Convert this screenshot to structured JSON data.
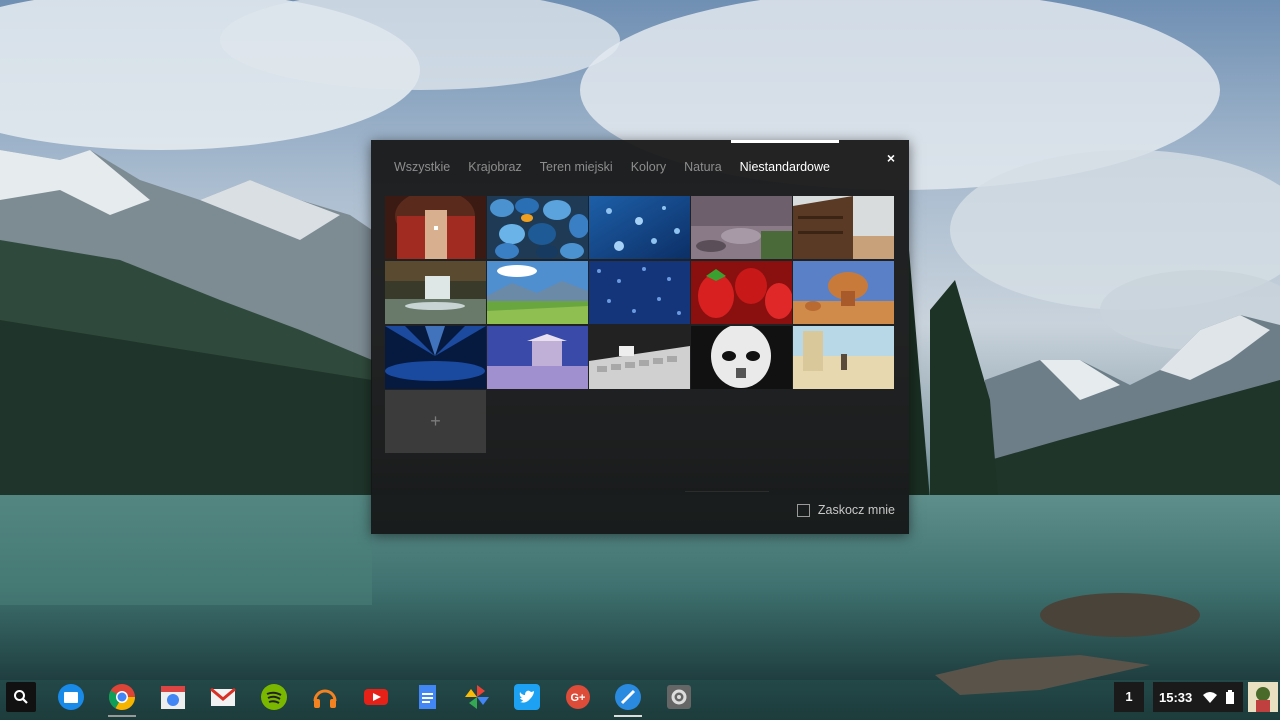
{
  "picker": {
    "tabs": [
      {
        "label": "Wszystkie",
        "active": false
      },
      {
        "label": "Krajobraz",
        "active": false
      },
      {
        "label": "Teren miejski",
        "active": false
      },
      {
        "label": "Kolory",
        "active": false
      },
      {
        "label": "Natura",
        "active": false
      },
      {
        "label": "Niestandardowe",
        "active": true
      }
    ],
    "close_icon": "×",
    "add_icon": "+",
    "surprise_label": "Zaskocz mnie",
    "surprise_checked": false
  },
  "wallpapers": [
    "person-with-headphones",
    "blue-pebbles",
    "water-drops",
    "rocky-stream",
    "wooden-cabin",
    "waterfall",
    "mountain-meadow",
    "rain-glass",
    "strawberries",
    "desert-rock",
    "blue-light-rays",
    "winter-shelter",
    "keyboard-figure",
    "stormtrooper",
    "desert-figure"
  ],
  "shelf": {
    "launcher_icon": "search-icon",
    "apps": [
      "files",
      "chrome",
      "chrome-web-store",
      "gmail",
      "spotify",
      "google-play-music",
      "youtube",
      "google-docs",
      "google-photos",
      "twitter",
      "google-plus",
      "pencil-app",
      "settings"
    ],
    "workspace_count": "1",
    "time": "15:33",
    "tray_icons": [
      "wifi-icon",
      "battery-icon"
    ]
  },
  "colors": {
    "accent": "#ffffff",
    "picker_bg": "#141414",
    "inactive_tab": "#8d8d8d"
  }
}
